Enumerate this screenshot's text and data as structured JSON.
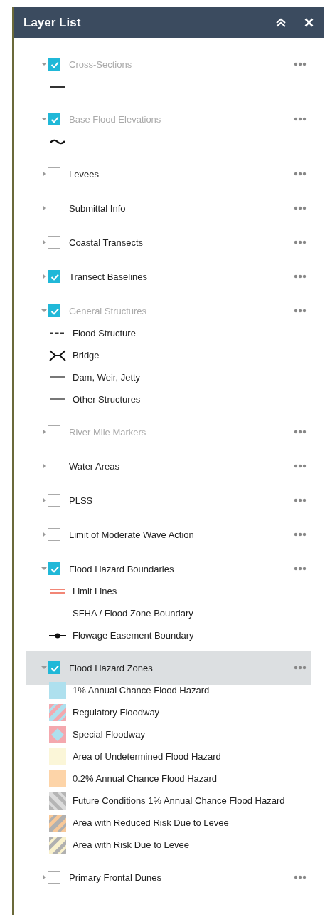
{
  "panel": {
    "title": "Layer List"
  },
  "layers": [
    {
      "label": "Cross-Sections",
      "checked": true,
      "expanded": true,
      "dimmed": true,
      "selected": false,
      "legend": [
        {
          "kind": "line"
        }
      ]
    },
    {
      "label": "Base Flood Elevations",
      "checked": true,
      "expanded": true,
      "dimmed": true,
      "selected": false,
      "legend": [
        {
          "kind": "wave"
        }
      ]
    },
    {
      "label": "Levees",
      "checked": false,
      "expanded": false,
      "dimmed": false,
      "selected": false
    },
    {
      "label": "Submittal Info",
      "checked": false,
      "expanded": false,
      "dimmed": false,
      "selected": false
    },
    {
      "label": "Coastal Transects",
      "checked": false,
      "expanded": false,
      "dimmed": false,
      "selected": false
    },
    {
      "label": "Transect Baselines",
      "checked": true,
      "expanded": false,
      "dimmed": false,
      "selected": false
    },
    {
      "label": "General Structures",
      "checked": true,
      "expanded": true,
      "dimmed": true,
      "selected": false,
      "legend": [
        {
          "kind": "dash",
          "label": "Flood Structure"
        },
        {
          "kind": "bridge",
          "label": "Bridge"
        },
        {
          "kind": "gray-line",
          "label": "Dam, Weir, Jetty"
        },
        {
          "kind": "gray-line",
          "label": "Other Structures"
        }
      ]
    },
    {
      "label": "River Mile Markers",
      "checked": false,
      "expanded": false,
      "dimmed": true,
      "selected": false
    },
    {
      "label": "Water Areas",
      "checked": false,
      "expanded": false,
      "dimmed": false,
      "selected": false
    },
    {
      "label": "PLSS",
      "checked": false,
      "expanded": false,
      "dimmed": false,
      "selected": false
    },
    {
      "label": "Limit of Moderate Wave Action",
      "checked": false,
      "expanded": false,
      "dimmed": false,
      "selected": false
    },
    {
      "label": "Flood Hazard Boundaries",
      "checked": true,
      "expanded": true,
      "dimmed": false,
      "selected": false,
      "legend": [
        {
          "kind": "double-line",
          "label": "Limit Lines"
        },
        {
          "kind": "blank",
          "label": "SFHA / Flood Zone Boundary"
        },
        {
          "kind": "dot-line",
          "label": "Flowage Easement Boundary"
        }
      ]
    },
    {
      "label": "Flood Hazard Zones",
      "checked": true,
      "expanded": true,
      "dimmed": false,
      "selected": true,
      "legend": [
        {
          "kind": "fill",
          "color": "#aee0ee",
          "label": "1% Annual Chance Flood Hazard"
        },
        {
          "kind": "floodway-hatch",
          "label": "Regulatory Floodway"
        },
        {
          "kind": "special-floodway",
          "label": "Special Floodway"
        },
        {
          "kind": "fill",
          "color": "#fbf6d8",
          "label": "Area of Undetermined Flood Hazard"
        },
        {
          "kind": "fill",
          "color": "#fdd4a8",
          "label": "0.2% Annual Chance Flood Hazard"
        },
        {
          "kind": "future-hatch",
          "label": "Future Conditions 1% Annual Chance Flood Hazard"
        },
        {
          "kind": "reduced-risk-hatch",
          "label": "Area with Reduced Risk Due to Levee"
        },
        {
          "kind": "risk-hatch",
          "label": "Area with Risk Due to Levee"
        }
      ]
    },
    {
      "label": "Primary Frontal Dunes",
      "checked": false,
      "expanded": false,
      "dimmed": false,
      "selected": false
    }
  ]
}
